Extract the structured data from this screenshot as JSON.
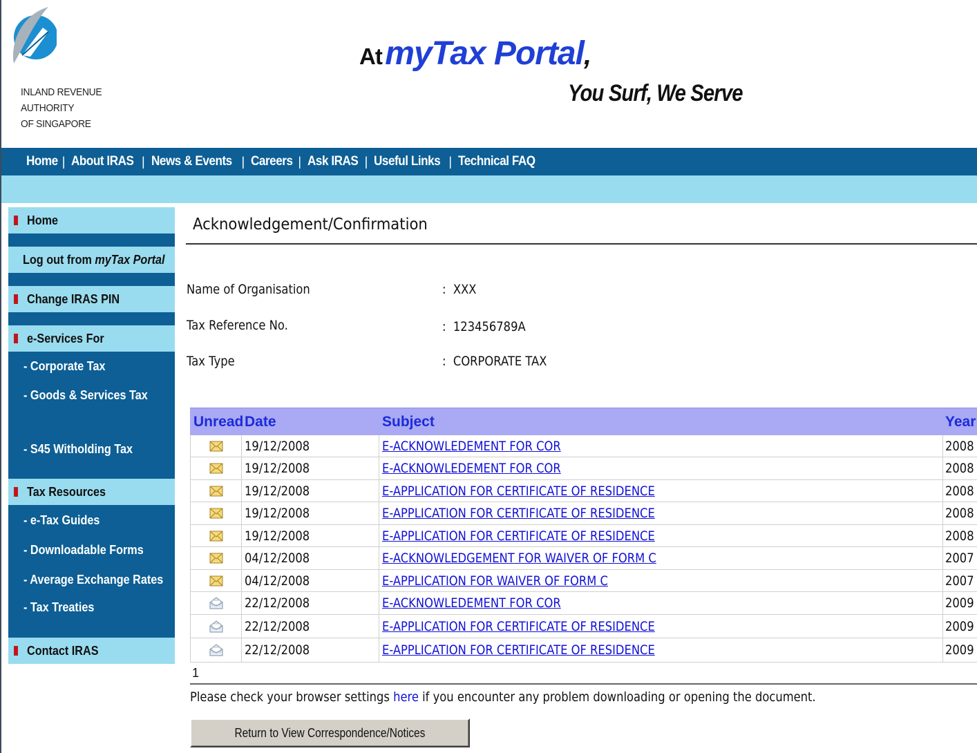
{
  "header": {
    "agency_name": "INLAND REVENUE\nAUTHORITY\nOF SINGAPORE",
    "tagline_at": "At",
    "tagline_brand": "myTax Portal",
    "tagline_comma": ",",
    "tagline_2": "You Surf, We Serve"
  },
  "topnav": [
    "Home",
    "About IRAS",
    "News & Events",
    "Careers",
    "Ask IRAS",
    "Useful Links",
    "Technical FAQ"
  ],
  "sidebar": {
    "home": "Home",
    "logout_prefix": "Log out from ",
    "logout_brand": "myTax Portal",
    "change_pin": "Change IRAS PIN",
    "eservices": "e-Services For",
    "eservices_items": [
      "- Corporate Tax",
      "- Goods & Services Tax",
      "- S45 Witholding Tax"
    ],
    "resources": "Tax Resources",
    "resources_items": [
      "- e-Tax Guides",
      "- Downloadable Forms",
      "- Average Exchange Rates",
      "- Tax Treaties"
    ],
    "contact": "Contact IRAS"
  },
  "main": {
    "title": "Acknowledgement/Confirmation",
    "org_label": "Name of Organisation",
    "org_colon": ":",
    "org_value": "XXX",
    "ref_label": "Tax Reference No.",
    "ref_colon": ":",
    "ref_value": "123456789A",
    "type_label": "Tax Type",
    "type_colon": ":",
    "type_value": "CORPORATE TAX"
  },
  "table": {
    "headers": {
      "unread": "Unread",
      "date": "Date",
      "subject": "Subject",
      "year": "Year"
    },
    "rows": [
      {
        "unread": true,
        "date": "19/12/2008",
        "subject": "E-ACKNOWLEDEMENT FOR COR",
        "year": "2008"
      },
      {
        "unread": true,
        "date": "19/12/2008",
        "subject": "E-ACKNOWLEDEMENT FOR COR",
        "year": "2008"
      },
      {
        "unread": true,
        "date": "19/12/2008",
        "subject": "E-APPLICATION FOR CERTIFICATE OF RESIDENCE",
        "year": "2008"
      },
      {
        "unread": true,
        "date": "19/12/2008",
        "subject": "E-APPLICATION FOR CERTIFICATE OF RESIDENCE",
        "year": "2008"
      },
      {
        "unread": true,
        "date": "19/12/2008",
        "subject": "E-APPLICATION FOR CERTIFICATE OF RESIDENCE",
        "year": "2008"
      },
      {
        "unread": true,
        "date": "04/12/2008",
        "subject": "E-ACKNOWLEDGEMENT FOR WAIVER OF FORM C",
        "year": "2007"
      },
      {
        "unread": true,
        "date": "04/12/2008",
        "subject": "E-APPLICATION FOR WAIVER OF FORM C",
        "year": "2007"
      },
      {
        "unread": false,
        "date": "22/12/2008",
        "subject": "E-ACKNOWLEDEMENT FOR COR",
        "year": "2009"
      },
      {
        "unread": false,
        "date": "22/12/2008",
        "subject": "E-APPLICATION FOR CERTIFICATE OF RESIDENCE",
        "year": "2009"
      },
      {
        "unread": false,
        "date": "22/12/2008",
        "subject": "E-APPLICATION FOR CERTIFICATE OF RESIDENCE",
        "year": "2009"
      }
    ],
    "page": "1"
  },
  "note": {
    "before": "Please check your browser settings ",
    "link": "here",
    "after": " if you encounter any problem downloading or opening the document."
  },
  "button_label": "Return to View Correspondence/Notices",
  "colors": {
    "nav_blue": "#0d5f95",
    "light_blue": "#99dcef",
    "table_header": "#a9a9f4",
    "link": "#1010d8",
    "bullet_red": "#c0161b"
  }
}
